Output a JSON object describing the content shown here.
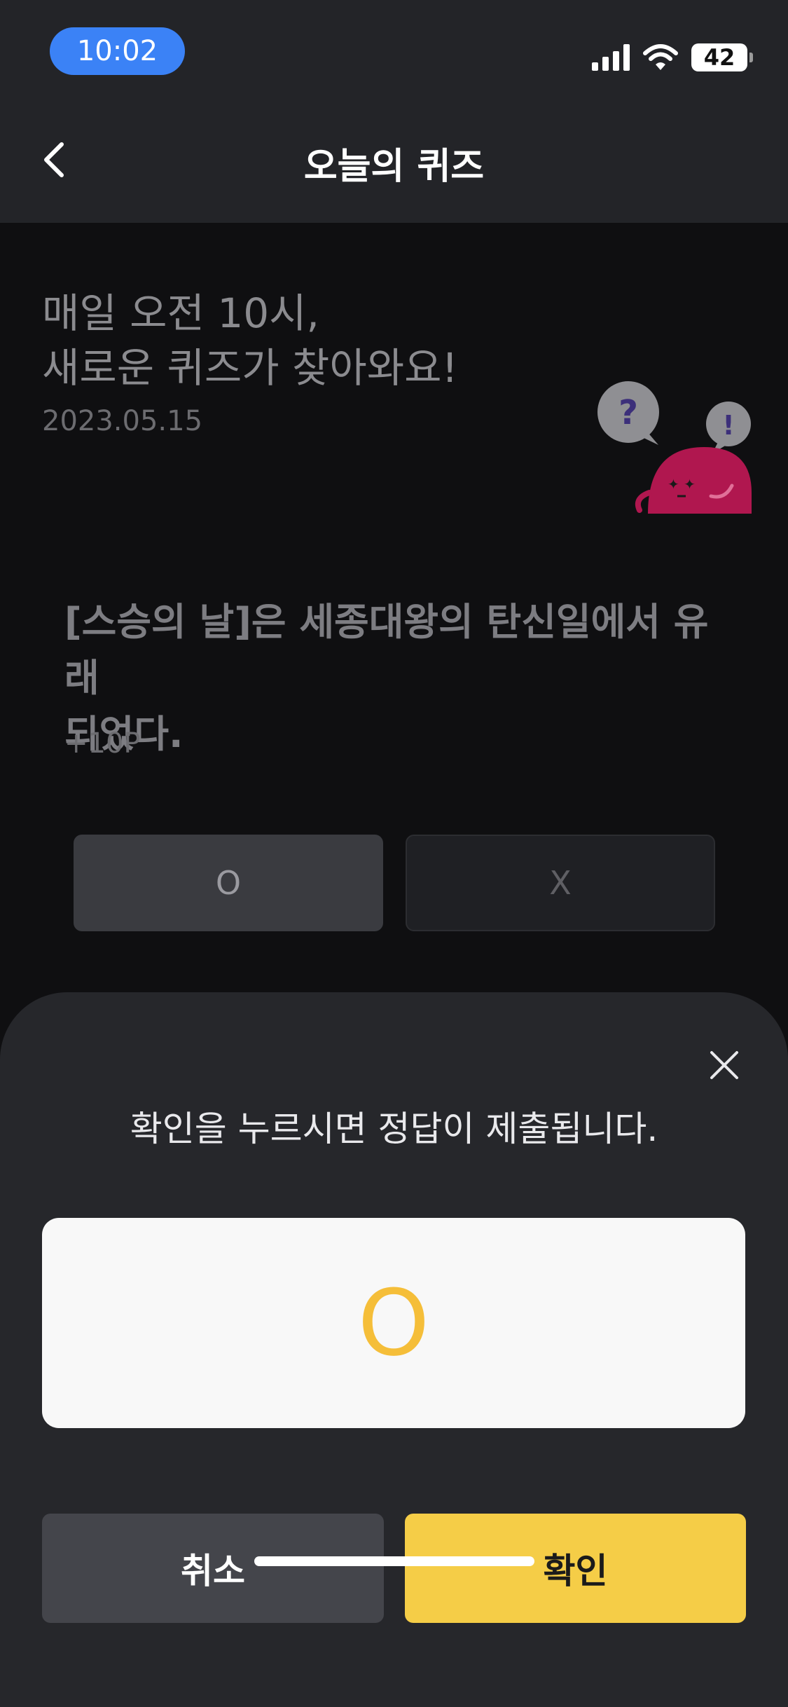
{
  "status_bar": {
    "time": "10:02",
    "battery_level": "42"
  },
  "nav": {
    "title": "오늘의 퀴즈"
  },
  "intro": {
    "line1": "매일 오전 10시,",
    "line2": "새로운 퀴즈가 찾아와요!",
    "date": "2023.05.15"
  },
  "quiz": {
    "question_line1": "[스승의 날]은 세종대왕의 탄신일에서 유래",
    "question_line2": "되었다.",
    "points": "+10P",
    "option_o": "O",
    "option_x": "X"
  },
  "sheet": {
    "prompt": "확인을 누르시면 정답이 제출됩니다.",
    "selected_answer": "O",
    "cancel_label": "취소",
    "confirm_label": "확인"
  },
  "colors": {
    "accent_yellow": "#F5CD47",
    "answer_orange": "#F5BE39",
    "time_pill_blue": "#3B82F6",
    "mascot_magenta": "#B0174F"
  },
  "icons": {
    "back": "chevron-left-icon",
    "close": "close-icon",
    "signal": "signal-icon",
    "wifi": "wifi-icon",
    "battery": "battery-icon",
    "mascot": "quiz-mascot-illustration"
  }
}
